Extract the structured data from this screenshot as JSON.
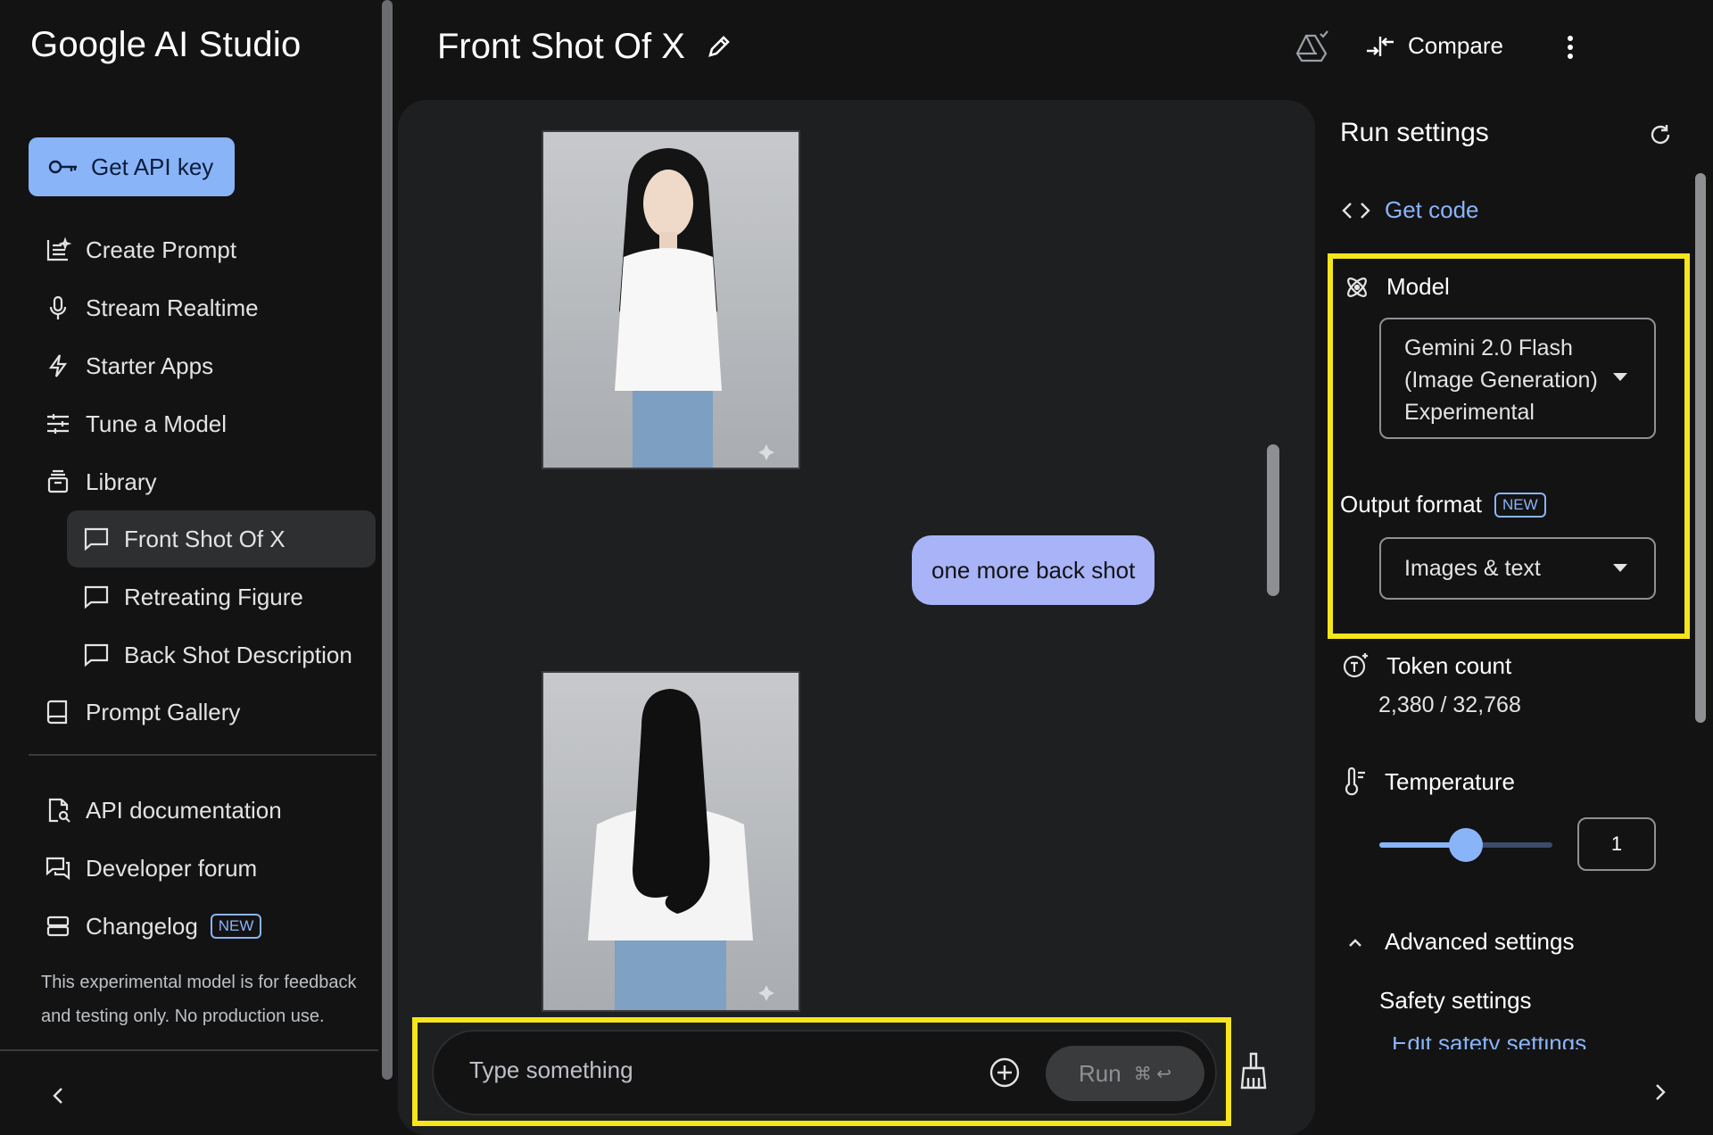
{
  "app": {
    "title": "Google AI Studio"
  },
  "sidebar": {
    "api_key_label": "Get API key",
    "nav": [
      {
        "label": "Create Prompt",
        "icon": "create-prompt-icon"
      },
      {
        "label": "Stream Realtime",
        "icon": "microphone-icon"
      },
      {
        "label": "Starter Apps",
        "icon": "bolt-icon"
      },
      {
        "label": "Tune a Model",
        "icon": "tune-icon"
      },
      {
        "label": "Library",
        "icon": "library-icon"
      }
    ],
    "library_items": [
      {
        "label": "Front Shot Of X",
        "active": true
      },
      {
        "label": "Retreating Figure",
        "active": false
      },
      {
        "label": "Back Shot Description",
        "active": false
      }
    ],
    "gallery_label": "Prompt Gallery",
    "links": [
      {
        "label": "API documentation",
        "icon": "api-docs-icon"
      },
      {
        "label": "Developer forum",
        "icon": "forum-icon"
      },
      {
        "label": "Changelog",
        "icon": "changelog-icon",
        "badge": "NEW"
      }
    ],
    "disclaimer": "This experimental model is for feedback and testing only. No production use."
  },
  "header": {
    "title": "Front Shot Of X",
    "compare_label": "Compare"
  },
  "chat": {
    "user_message": "one more back shot",
    "input_placeholder": "Type something",
    "run_label": "Run",
    "run_shortcut": "⌘ ↩"
  },
  "settings": {
    "title": "Run settings",
    "get_code_label": "Get code",
    "model_label": "Model",
    "model_value": [
      "Gemini 2.0 Flash",
      "(Image Generation)",
      "Experimental"
    ],
    "output_format_label": "Output format",
    "output_format_badge": "NEW",
    "output_format_value": "Images & text",
    "token_count_label": "Token count",
    "token_count_value": "2,380 / 32,768",
    "temperature_label": "Temperature",
    "temperature_value": "1",
    "temperature_fraction": 0.5,
    "advanced_label": "Advanced settings",
    "safety_label": "Safety settings",
    "edit_safety_label": "Edit safety settings"
  },
  "colors": {
    "accent": "#8ab4f8",
    "highlight": "#f5e51b",
    "bubble": "#a8b4f7"
  }
}
